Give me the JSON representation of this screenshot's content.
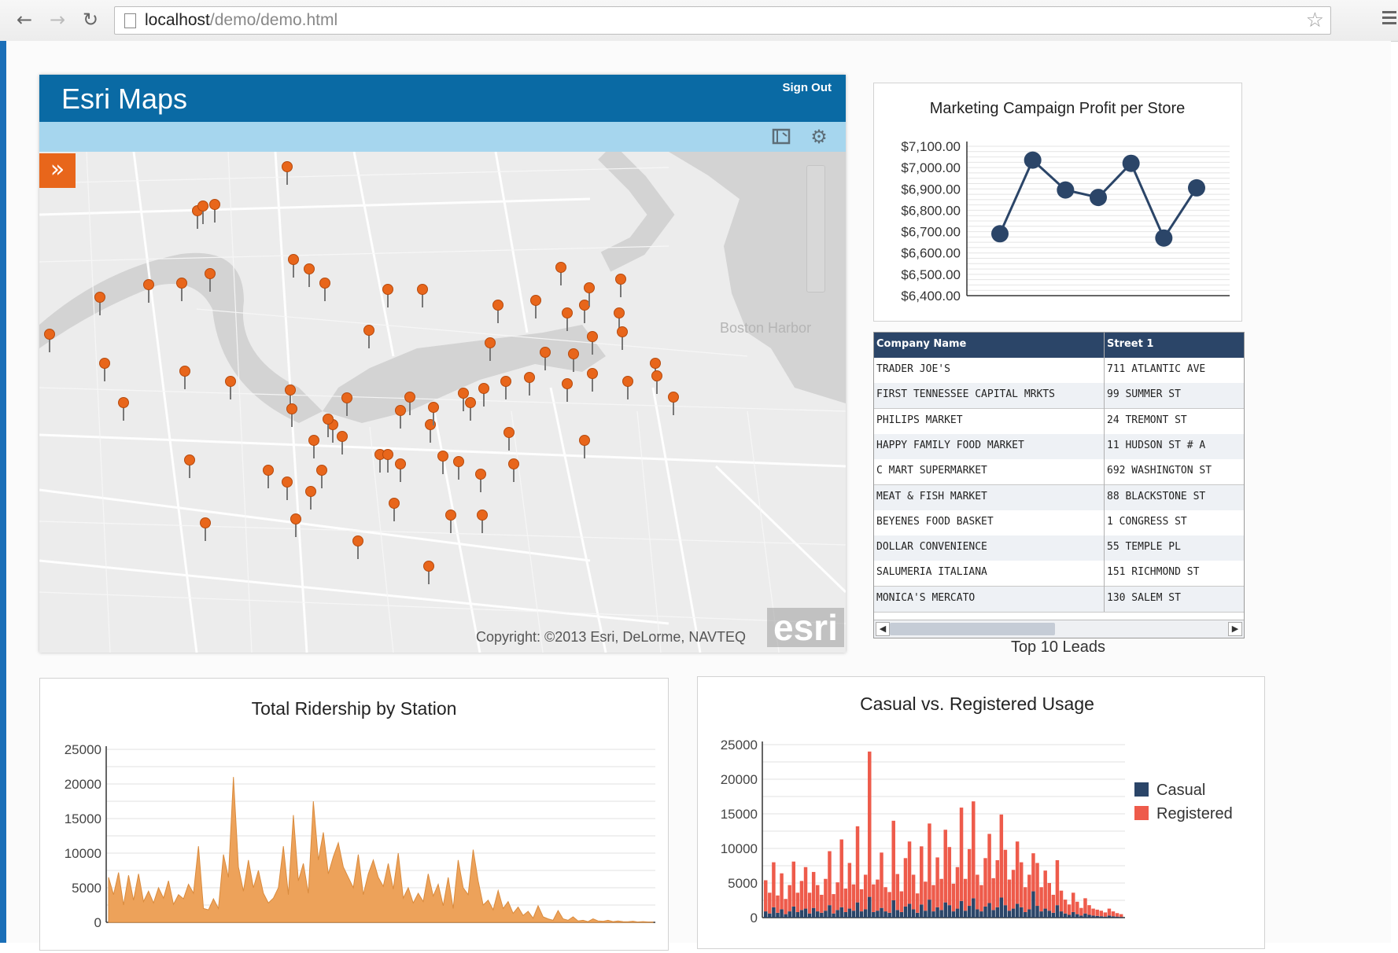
{
  "browser": {
    "url_host": "localhost",
    "url_path": "/demo/demo.html",
    "icons": [
      "back-icon",
      "forward-icon",
      "reload-icon",
      "page-icon",
      "star-icon",
      "menu-icon"
    ]
  },
  "map": {
    "title": "Esri Maps",
    "sign_out_label": "Sign Out",
    "expand_icon": "»",
    "water_label": "Boston Harbor",
    "copyright": "Copyright: ©2013 Esri, DeLorme, NAVTEQ",
    "logo_text": "esri",
    "pin_color": "#e8661b"
  },
  "line_chart": {
    "chart_data": {
      "type": "line",
      "title": "Marketing Campaign Profit per Store",
      "yticks": [
        "$7,100.00",
        "$7,000.00",
        "$6,900.00",
        "$6,800.00",
        "$6,700.00",
        "$6,600.00",
        "$6,500.00",
        "$6,400.00"
      ],
      "ylim": [
        6400,
        7100
      ],
      "values": [
        6690,
        7035,
        6895,
        6860,
        7020,
        6670,
        6905
      ],
      "color": "#2b4568"
    }
  },
  "leads_table": {
    "caption": "Top 10 Leads",
    "columns": [
      "Company Name",
      "Street 1"
    ],
    "rows": [
      [
        "TRADER JOE'S",
        "711 ATLANTIC AVE"
      ],
      [
        "FIRST TENNESSEE CAPITAL MRKTS",
        "99 SUMMER ST"
      ],
      [
        "PHILIPS MARKET",
        "24 TREMONT ST"
      ],
      [
        "HAPPY FAMILY FOOD MARKET",
        "11 HUDSON ST # A"
      ],
      [
        "C MART SUPERMARKET",
        "692 WASHINGTON ST"
      ],
      [
        "MEAT & FISH MARKET",
        "88 BLACKSTONE ST"
      ],
      [
        "BEYENES FOOD BASKET",
        "1 CONGRESS ST"
      ],
      [
        "DOLLAR CONVENIENCE",
        "55 TEMPLE PL"
      ],
      [
        "SALUMERIA ITALIANA",
        "151 RICHMOND ST"
      ],
      [
        "MONICA'S MERCATO",
        "130 SALEM ST"
      ]
    ]
  },
  "ridership_chart": {
    "chart_data": {
      "type": "area",
      "title": "Total Ridership by Station",
      "yticks": [
        "25000",
        "20000",
        "15000",
        "10000",
        "5000",
        "0"
      ],
      "ylim": [
        0,
        25000
      ],
      "color": "#eda25a",
      "values": [
        6500,
        4000,
        7200,
        2500,
        6800,
        3200,
        7000,
        3000,
        4500,
        2800,
        5000,
        3500,
        6000,
        2600,
        4000,
        3400,
        5500,
        4200,
        11000,
        2000,
        1800,
        3400,
        2000,
        9800,
        6500,
        21000,
        8000,
        4500,
        9000,
        5000,
        7500,
        4200,
        2800,
        3500,
        5000,
        11000,
        4000,
        15500,
        6000,
        8500,
        4200,
        17500,
        9000,
        13000,
        7000,
        9500,
        11500,
        8000,
        6500,
        5000,
        9800,
        4000,
        7000,
        9000,
        6500,
        5200,
        8500,
        4800,
        10000,
        3500,
        5000,
        2800,
        4200,
        3000,
        7000,
        3800,
        5500,
        2400,
        6500,
        2000,
        9000,
        5000,
        4000,
        10500,
        6000,
        2500,
        3200,
        1800,
        4600,
        2000,
        3000,
        1300,
        2200,
        1000,
        1600,
        600,
        2400,
        800,
        500,
        300,
        1700,
        500,
        300,
        800,
        200,
        300,
        100,
        500,
        200,
        150,
        300,
        100,
        200,
        100,
        80,
        150,
        50,
        100,
        60,
        40
      ]
    }
  },
  "usage_chart": {
    "chart_data": {
      "type": "bar",
      "title": "Casual vs. Registered Usage",
      "yticks": [
        "25000",
        "20000",
        "15000",
        "10000",
        "5000",
        "0"
      ],
      "ylim": [
        0,
        25000
      ],
      "series": [
        {
          "name": "Casual",
          "color": "#2b4568",
          "values": [
            900,
            600,
            1500,
            700,
            1200,
            500,
            900,
            1600,
            800,
            1100,
            1300,
            600,
            1400,
            900,
            700,
            1000,
            1800,
            600,
            1100,
            1500,
            800,
            1300,
            1000,
            2200,
            900,
            1200,
            3000,
            800,
            1000,
            1400,
            900,
            700,
            2500,
            1100,
            800,
            1600,
            2000,
            1200,
            700,
            1900,
            1000,
            2600,
            900,
            1500,
            1100,
            2200,
            1800,
            900,
            1300,
            2400,
            1000,
            1700,
            2800,
            1200,
            900,
            1600,
            2100,
            1100,
            1500,
            2900,
            1800,
            1000,
            1300,
            2000,
            1500,
            800,
            1200,
            3800,
            1700,
            900,
            1300,
            1000,
            700,
            1800,
            900,
            600,
            400,
            800,
            500,
            300,
            600,
            400,
            300,
            250,
            200,
            150,
            300,
            200,
            150,
            100
          ]
        },
        {
          "name": "Registered",
          "color": "#ee5b4b",
          "values": [
            4500,
            3000,
            6500,
            2500,
            5200,
            2200,
            3800,
            6500,
            2800,
            4200,
            6000,
            3000,
            5200,
            3800,
            2600,
            4600,
            7800,
            2800,
            4000,
            9800,
            3400,
            6600,
            3800,
            11000,
            3200,
            5000,
            21000,
            4000,
            4500,
            8000,
            3500,
            3000,
            11500,
            5200,
            3000,
            7000,
            9000,
            5000,
            2800,
            8400,
            4200,
            11000,
            3800,
            7200,
            4500,
            10500,
            8400,
            4000,
            6000,
            13500,
            4600,
            8200,
            14000,
            5000,
            3800,
            7000,
            10000,
            4600,
            6800,
            12000,
            8000,
            4500,
            5600,
            9000,
            6500,
            3600,
            5000,
            5500,
            6200,
            3500,
            5500,
            4000,
            2600,
            6500,
            3000,
            2000,
            1500,
            2800,
            1800,
            1100,
            2200,
            1400,
            1000,
            900,
            800,
            600,
            1000,
            700,
            500,
            400
          ]
        }
      ],
      "legend": "right"
    }
  }
}
